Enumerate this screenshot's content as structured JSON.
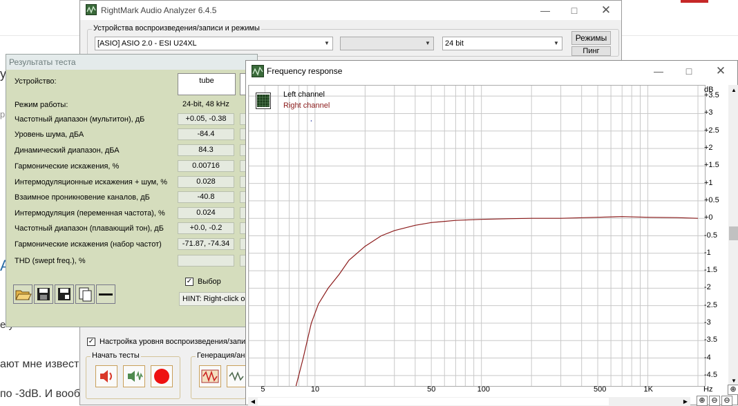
{
  "background": {
    "fragment1": "у",
    "fragment2": "р",
    "fragment3": "А",
    "fragment4": "е у",
    "fragment5": "ают мне извест",
    "fragment6": "по -3dB. И вооб"
  },
  "main_window": {
    "title": "RightMark Audio Analyzer 6.4.5",
    "devices_group_label": "Устройства воспроизведения/записи и режимы",
    "device_combo": "[ASIO] ASIO 2.0 - ESI U24XL",
    "bits_combo": "24 bit",
    "modes_button": "Режимы",
    "ping_button": "Пинг",
    "playback_level_checkbox_label": "Настройка уровня воспроизведения/запи",
    "start_tests_group_label": "Начать тесты",
    "generation_group_label": "Генерация/ана"
  },
  "results_window": {
    "title": "Результаты теста",
    "device_label": "Устройство:",
    "device_value": "tube",
    "mode_label": "Режим работы:",
    "mode_value": "24-bit, 48 kHz",
    "rows": [
      {
        "label": "Частотный диапазон (мультитон), дБ",
        "value": "+0.05, -0.38"
      },
      {
        "label": "Уровень шума, дБА",
        "value": "-84.4"
      },
      {
        "label": "Динамический диапазон, дБА",
        "value": "84.3"
      },
      {
        "label": "Гармонические искажения, %",
        "value": "0.00716"
      },
      {
        "label": "Интермодуляционные искажения + шум, %",
        "value": "0.028"
      },
      {
        "label": "Взаимное проникновение каналов, дБ",
        "value": "-40.8"
      },
      {
        "label": "Интермодуляция (переменная частота), %",
        "value": "0.024"
      },
      {
        "label": "Частотный диапазон (плавающий тон), дБ",
        "value": "+0.0, -0.2"
      },
      {
        "label": "Гармонические искажения (набор частот)",
        "value": "-71.87, -74.34"
      },
      {
        "label": "THD (swept freq.), %",
        "value": ""
      }
    ],
    "select_checkbox_label": "Выбор",
    "hint_text": "HINT: Right-click o"
  },
  "freq_window": {
    "title": "Frequency response",
    "legend_left": "Left channel",
    "legend_right": "Right channel",
    "y_unit": "dB",
    "x_unit": "Hz",
    "colors": {
      "right_channel": "#8b1a1a",
      "grid": "#c8c8c8"
    }
  },
  "chart_data": {
    "type": "line",
    "title": "Frequency response",
    "xlabel": "Hz",
    "ylabel": "dB",
    "x_scale": "log",
    "grid": true,
    "legend_position": "top-left",
    "xlim": [
      4,
      2200
    ],
    "ylim": [
      -4.8,
      3.8
    ],
    "x_ticks": [
      "5",
      "10",
      "50",
      "100",
      "500",
      "1K"
    ],
    "y_ticks": [
      "+3.5",
      "+3",
      "+2.5",
      "+2",
      "+1.5",
      "+1",
      "+0.5",
      "+0",
      "-0.5",
      "-1",
      "-1.5",
      "-2",
      "-2.5",
      "-3",
      "-3.5",
      "-4",
      "-4.5"
    ],
    "series": [
      {
        "name": "Right channel",
        "color": "#8b1a1a",
        "x": [
          7.5,
          8.5,
          9.5,
          10.5,
          12,
          14,
          16,
          20,
          25,
          30,
          40,
          50,
          70,
          100,
          150,
          200,
          300,
          500,
          700,
          1000,
          1500,
          2000
        ],
        "y": [
          -5.0,
          -4.0,
          -3.0,
          -2.45,
          -2.0,
          -1.6,
          -1.2,
          -0.8,
          -0.5,
          -0.35,
          -0.2,
          -0.12,
          -0.06,
          -0.03,
          -0.01,
          0.0,
          0.0,
          0.03,
          0.05,
          0.03,
          0.02,
          0.0
        ]
      },
      {
        "name": "Left channel",
        "color": "#2030a0",
        "x": [],
        "y": []
      }
    ]
  }
}
